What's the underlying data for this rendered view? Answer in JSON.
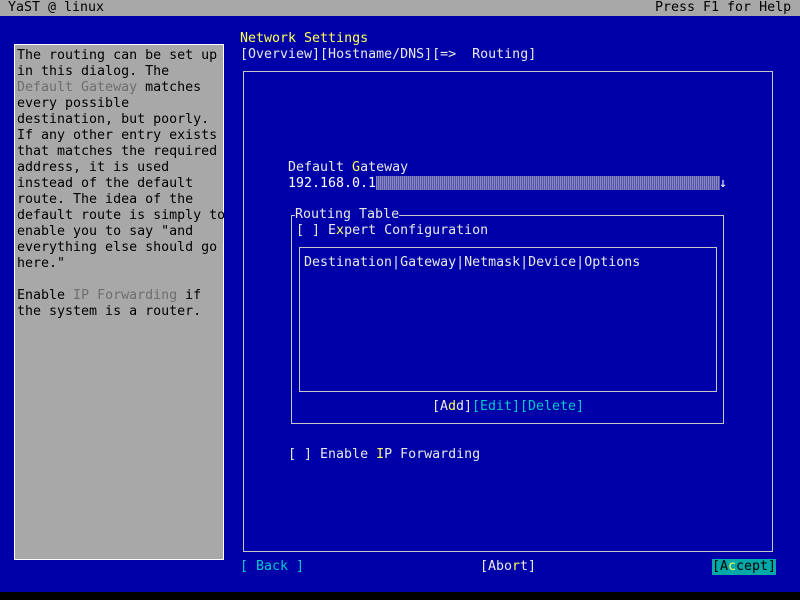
{
  "window": {
    "title": "YaST @ linux",
    "help_hint": "Press F1 for Help"
  },
  "help": {
    "lines": [
      {
        "pre": "The routing can be set up",
        "hl": "",
        "post": ""
      },
      {
        "pre": "in this dialog. The",
        "hl": "",
        "post": ""
      },
      {
        "pre": "",
        "hl": "Default Gateway",
        "post": " matches"
      },
      {
        "pre": "every possible",
        "hl": "",
        "post": ""
      },
      {
        "pre": "destination, but poorly.",
        "hl": "",
        "post": ""
      },
      {
        "pre": "If any other entry exists",
        "hl": "",
        "post": ""
      },
      {
        "pre": "that matches the required",
        "hl": "",
        "post": ""
      },
      {
        "pre": "address, it is used",
        "hl": "",
        "post": ""
      },
      {
        "pre": "instead of the default",
        "hl": "",
        "post": ""
      },
      {
        "pre": "route. The idea of the",
        "hl": "",
        "post": ""
      },
      {
        "pre": "default route is simply to",
        "hl": "",
        "post": ""
      },
      {
        "pre": "enable you to say \"and",
        "hl": "",
        "post": ""
      },
      {
        "pre": "everything else should go",
        "hl": "",
        "post": ""
      },
      {
        "pre": "here.\"",
        "hl": "",
        "post": ""
      },
      {
        "pre": "",
        "hl": "",
        "post": ""
      },
      {
        "pre": "Enable ",
        "hl": "IP Forwarding",
        "post": " if"
      },
      {
        "pre": "the system is a router.",
        "hl": "",
        "post": ""
      }
    ]
  },
  "dialog": {
    "title": "Network Settings",
    "tabs": "[Overview][Hostname/DNS][=>  Routing]",
    "gateway": {
      "label_pre": "Default ",
      "label_hot": "G",
      "label_post": "ateway",
      "value": "192.168.0.1",
      "arrow": "↓"
    },
    "routing_table": {
      "title": "Routing Table",
      "expert": {
        "check": "[ ]",
        "pre": " E",
        "hot": "x",
        "post": "pert Configuration"
      },
      "columns": "Destination|Gateway|Netmask|Device|Options",
      "buttons": {
        "add": {
          "pre": "[A",
          "hot": "d",
          "post": "d]"
        },
        "edit": "[Edit]",
        "delete": "[Delete]"
      }
    },
    "ip_forwarding": {
      "check": "[ ]",
      "pre": " Enable ",
      "hot": "I",
      "post": "P Forwarding"
    }
  },
  "footer": {
    "back": "[ Back ]",
    "abort": {
      "pre": "[Abo",
      "hot": "r",
      "post": "t]"
    },
    "accept": {
      "pre": "[A",
      "hot": "c",
      "post": "cept]"
    }
  }
}
